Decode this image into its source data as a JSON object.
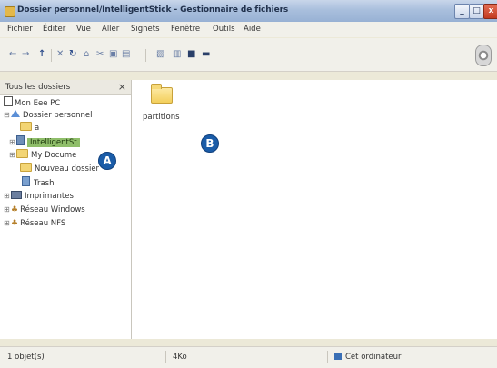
{
  "window": {
    "title": "Dossier personnel/IntelligentStick - Gestionnaire de fichiers",
    "buttons": {
      "minimize": "_",
      "maximize": "□",
      "close": "x"
    }
  },
  "menu": {
    "items": [
      "Fichier",
      "Éditer",
      "Vue",
      "Aller",
      "Signets",
      "Fenêtre",
      "Outils",
      "Aide"
    ]
  },
  "toolbar": {
    "icons": [
      "back-icon",
      "forward-icon",
      "up-icon",
      "stop-icon",
      "reload-icon",
      "home-icon",
      "cut-icon",
      "copy-icon",
      "paste-icon",
      "properties-icon",
      "view-icon",
      "view-icon-2",
      "view-icon-3"
    ],
    "glyphs": {
      "back": "←",
      "forward": "→",
      "up": "↑",
      "stop": "✕",
      "reload": "↻",
      "home": "⌂",
      "cut": "✂",
      "copy": "▣",
      "paste": "▤",
      "properties": "▧",
      "view1": "▥",
      "view2": "■",
      "view3": "▬"
    }
  },
  "sidebar": {
    "title": "Tous les dossiers",
    "close": "×",
    "tree": {
      "root": "Mon Eee PC",
      "home": "Dossier personnel",
      "a": "a",
      "stick": "IntelligentSt",
      "mydocs": "My Docume",
      "newfolder": "Nouveau dossier",
      "trash": "Trash",
      "printers": "Imprimantes",
      "winnet": "Réseau Windows",
      "nfs": "Réseau NFS"
    }
  },
  "main": {
    "items": [
      {
        "label": "partitions",
        "icon": "folder-icon"
      }
    ]
  },
  "markers": {
    "a": "A",
    "b": "B"
  },
  "status": {
    "count": "1 objet(s)",
    "size": "4Ko",
    "location": "Cet ordinateur"
  }
}
